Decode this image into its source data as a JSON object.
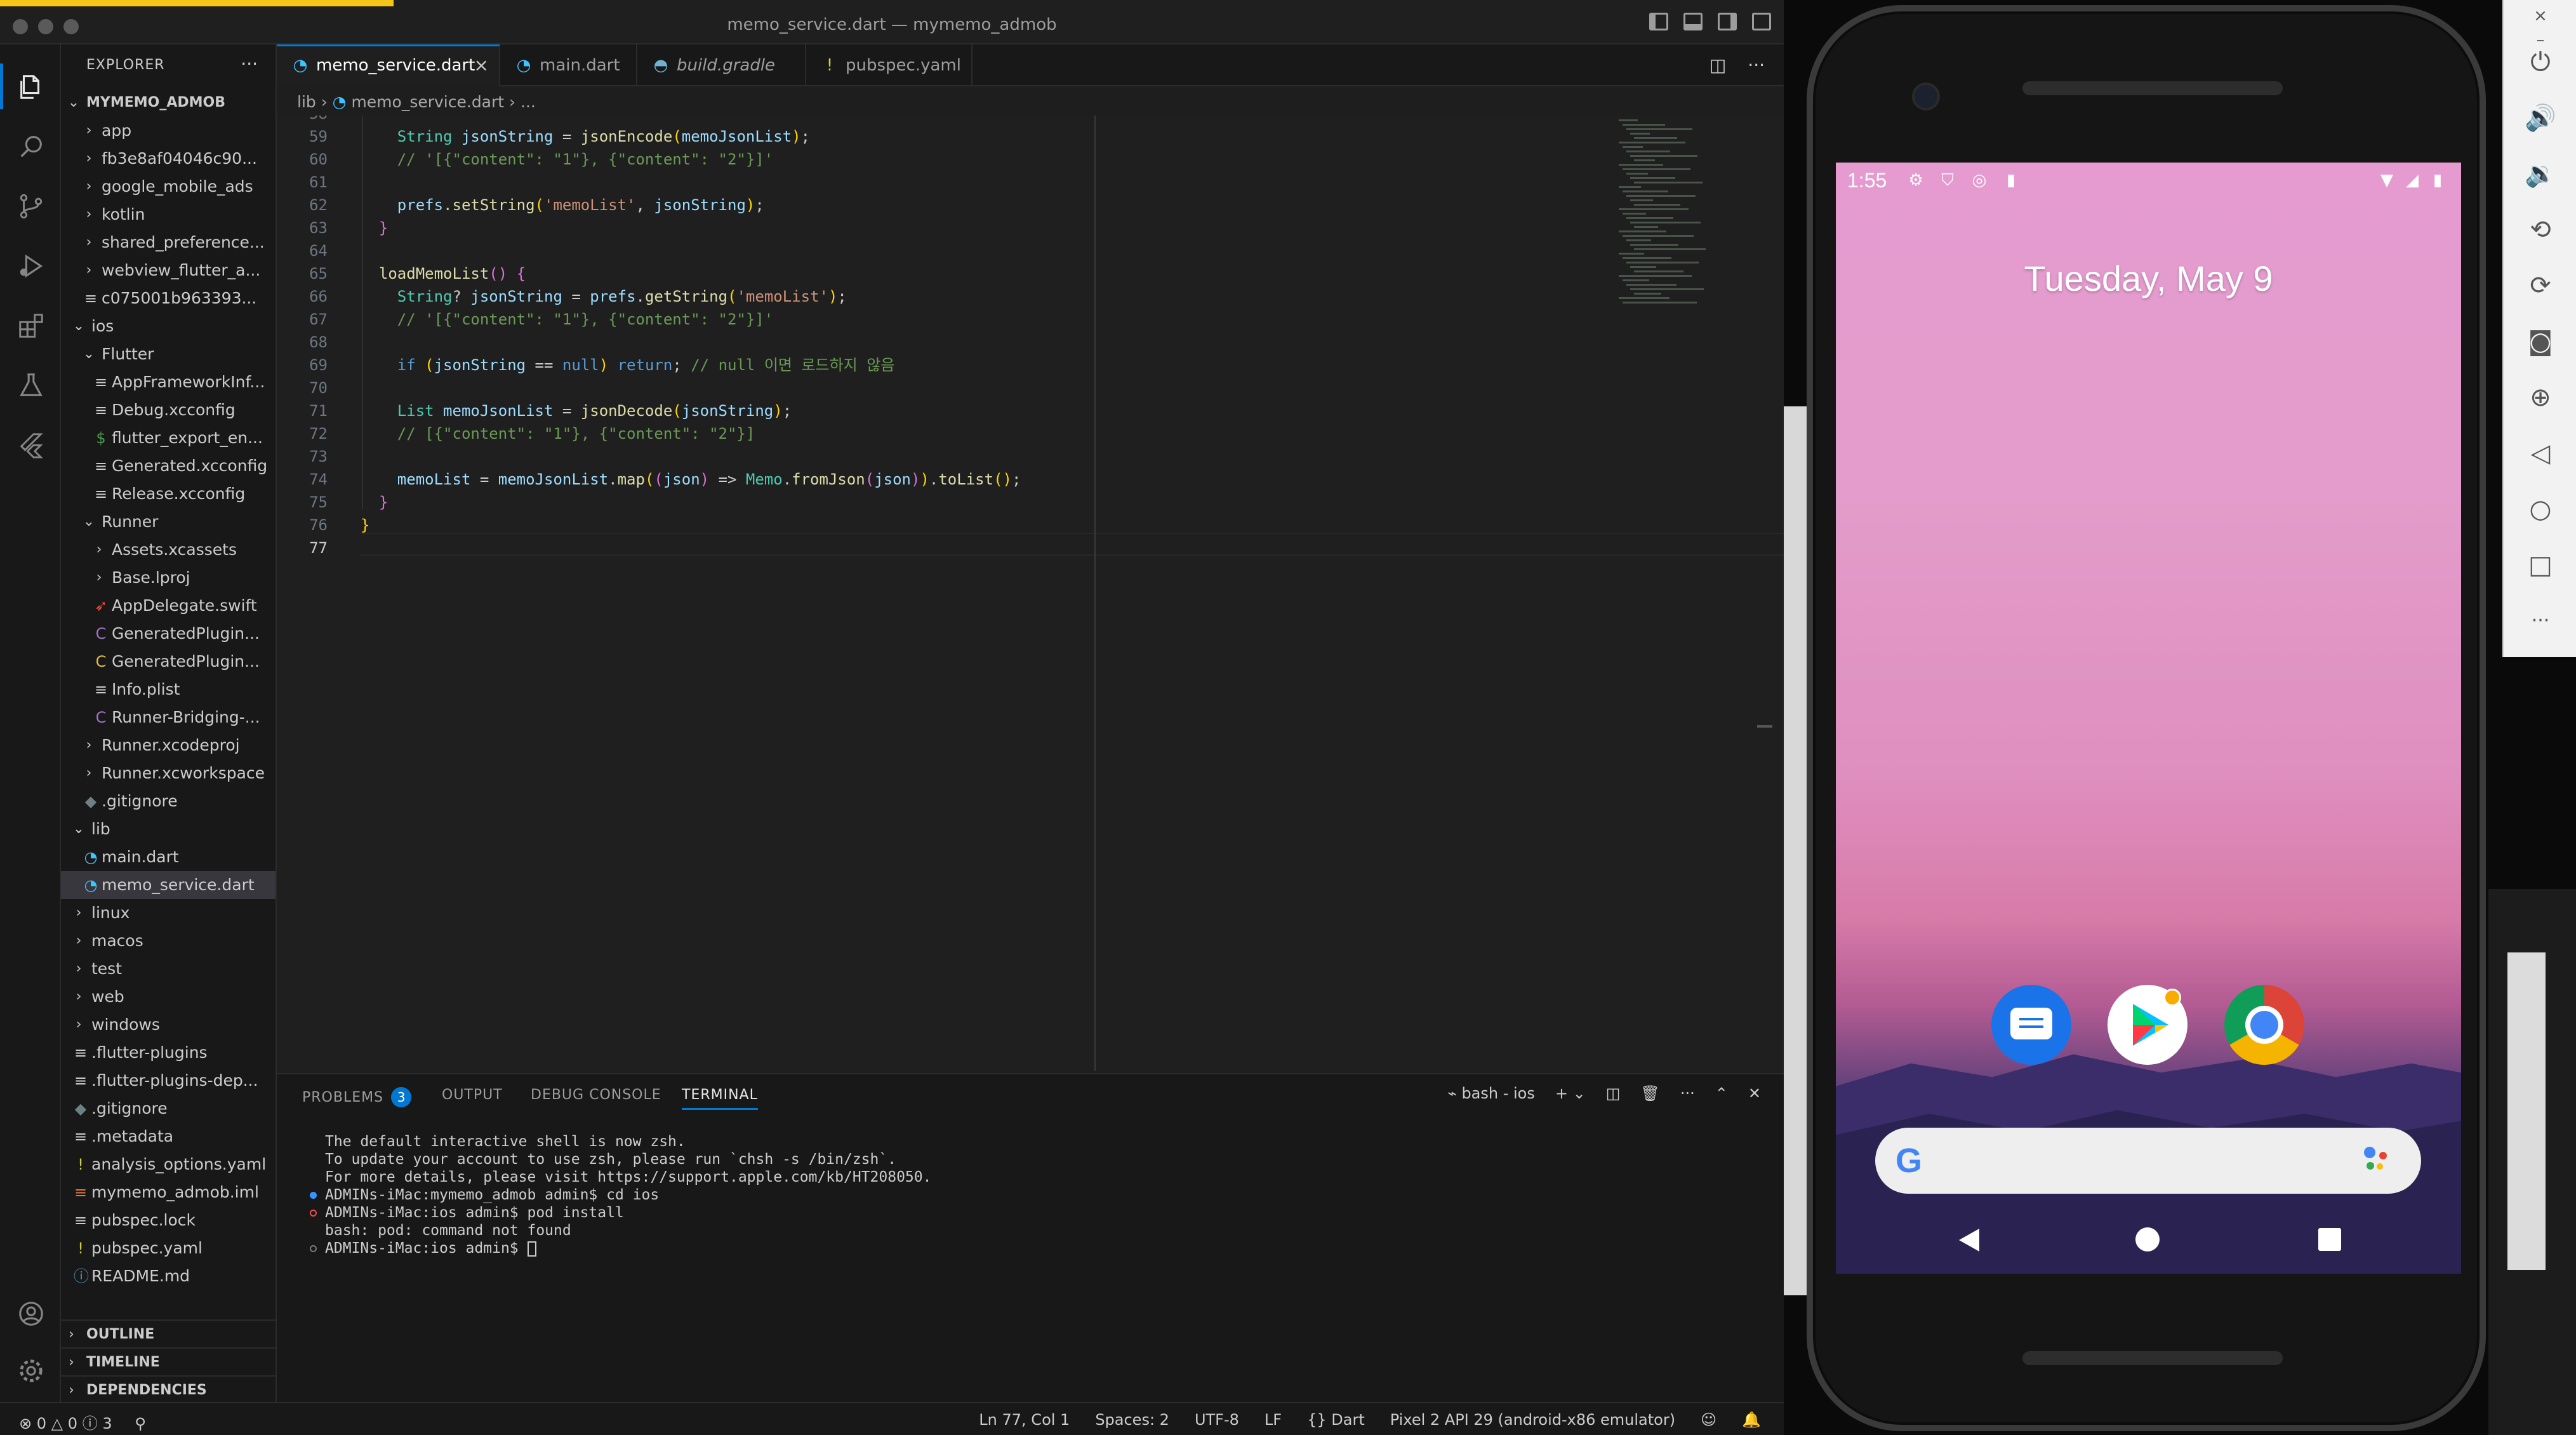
{
  "window": {
    "title": "memo_service.dart — mymemo_admob"
  },
  "explorer": {
    "title": "EXPLORER",
    "more": "···",
    "project": "MYMEMO_ADMOB",
    "items": [
      {
        "label": "app",
        "depth": 1,
        "type": "folder",
        "open": false
      },
      {
        "label": "fb3e8af04046c90...",
        "depth": 1,
        "type": "folder",
        "open": false
      },
      {
        "label": "google_mobile_ads",
        "depth": 1,
        "type": "folder",
        "open": false
      },
      {
        "label": "kotlin",
        "depth": 1,
        "type": "folder",
        "open": false
      },
      {
        "label": "shared_preference...",
        "depth": 1,
        "type": "folder",
        "open": false
      },
      {
        "label": "webview_flutter_a...",
        "depth": 1,
        "type": "folder",
        "open": false
      },
      {
        "label": "c075001b963393...",
        "depth": 1,
        "type": "file",
        "icon": "lines"
      },
      {
        "label": "ios",
        "depth": 0,
        "type": "folder",
        "open": true
      },
      {
        "label": "Flutter",
        "depth": 1,
        "type": "folder",
        "open": true
      },
      {
        "label": "AppFrameworkInf...",
        "depth": 2,
        "type": "file",
        "icon": "lines"
      },
      {
        "label": "Debug.xcconfig",
        "depth": 2,
        "type": "file",
        "icon": "lines"
      },
      {
        "label": "flutter_export_en...",
        "depth": 2,
        "type": "file",
        "icon": "dollar"
      },
      {
        "label": "Generated.xcconfig",
        "depth": 2,
        "type": "file",
        "icon": "lines"
      },
      {
        "label": "Release.xcconfig",
        "depth": 2,
        "type": "file",
        "icon": "lines"
      },
      {
        "label": "Runner",
        "depth": 1,
        "type": "folder",
        "open": true
      },
      {
        "label": "Assets.xcassets",
        "depth": 2,
        "type": "folder",
        "open": false
      },
      {
        "label": "Base.lproj",
        "depth": 2,
        "type": "folder",
        "open": false
      },
      {
        "label": "AppDelegate.swift",
        "depth": 2,
        "type": "file",
        "icon": "swift"
      },
      {
        "label": "GeneratedPlugin...",
        "depth": 2,
        "type": "file",
        "icon": "c-purple"
      },
      {
        "label": "GeneratedPlugin...",
        "depth": 2,
        "type": "file",
        "icon": "c-yellow"
      },
      {
        "label": "Info.plist",
        "depth": 2,
        "type": "file",
        "icon": "lines"
      },
      {
        "label": "Runner-Bridging-...",
        "depth": 2,
        "type": "file",
        "icon": "c-purple"
      },
      {
        "label": "Runner.xcodeproj",
        "depth": 1,
        "type": "folder",
        "open": false
      },
      {
        "label": "Runner.xcworkspace",
        "depth": 1,
        "type": "folder",
        "open": false
      },
      {
        "label": ".gitignore",
        "depth": 1,
        "type": "file",
        "icon": "git"
      },
      {
        "label": "lib",
        "depth": 0,
        "type": "folder",
        "open": true
      },
      {
        "label": "main.dart",
        "depth": 1,
        "type": "file",
        "icon": "dart"
      },
      {
        "label": "memo_service.dart",
        "depth": 1,
        "type": "file",
        "icon": "dart",
        "selected": true
      },
      {
        "label": "linux",
        "depth": 0,
        "type": "folder",
        "open": false
      },
      {
        "label": "macos",
        "depth": 0,
        "type": "folder",
        "open": false
      },
      {
        "label": "test",
        "depth": 0,
        "type": "folder",
        "open": false
      },
      {
        "label": "web",
        "depth": 0,
        "type": "folder",
        "open": false
      },
      {
        "label": "windows",
        "depth": 0,
        "type": "folder",
        "open": false
      },
      {
        "label": ".flutter-plugins",
        "depth": 0,
        "type": "file",
        "icon": "lines"
      },
      {
        "label": ".flutter-plugins-dep...",
        "depth": 0,
        "type": "file",
        "icon": "lines"
      },
      {
        "label": ".gitignore",
        "depth": 0,
        "type": "file",
        "icon": "git"
      },
      {
        "label": ".metadata",
        "depth": 0,
        "type": "file",
        "icon": "lines"
      },
      {
        "label": "analysis_options.yaml",
        "depth": 0,
        "type": "file",
        "icon": "excl"
      },
      {
        "label": "mymemo_admob.iml",
        "depth": 0,
        "type": "file",
        "icon": "iml"
      },
      {
        "label": "pubspec.lock",
        "depth": 0,
        "type": "file",
        "icon": "lines"
      },
      {
        "label": "pubspec.yaml",
        "depth": 0,
        "type": "file",
        "icon": "excl"
      },
      {
        "label": "README.md",
        "depth": 0,
        "type": "file",
        "icon": "info"
      }
    ],
    "sections": [
      "OUTLINE",
      "TIMELINE",
      "DEPENDENCIES"
    ]
  },
  "tabs": [
    {
      "label": "memo_service.dart",
      "icon": "dart",
      "active": true,
      "close": "×"
    },
    {
      "label": "main.dart",
      "icon": "dart"
    },
    {
      "label": "build.gradle",
      "icon": "gradle",
      "italic": true
    },
    {
      "label": "pubspec.yaml",
      "icon": "excl"
    }
  ],
  "breadcrumb": {
    "folder": "lib",
    "file": "memo_service.dart",
    "rest": "..."
  },
  "code": {
    "lines": [
      {
        "n": "58",
        "html": ""
      },
      {
        "n": "59",
        "html": "    <span class='ty'>String</span> <span class='vr'>jsonString</span> = <span class='fn'>jsonEncode</span><span class='br2'>(</span><span class='vr'>memoJsonList</span><span class='br2'>)</span>;"
      },
      {
        "n": "60",
        "html": "    <span class='cm'>// '[{\"content\": \"1\"}, {\"content\": \"2\"}]'</span>"
      },
      {
        "n": "61",
        "html": ""
      },
      {
        "n": "62",
        "html": "    <span class='vr'>prefs</span>.<span class='fn'>setString</span><span class='br2'>(</span><span class='str'>'memoList'</span>, <span class='vr'>jsonString</span><span class='br2'>)</span>;"
      },
      {
        "n": "63",
        "html": "  <span class='br'>}</span>"
      },
      {
        "n": "64",
        "html": ""
      },
      {
        "n": "65",
        "html": "  <span class='fn'>loadMemoList</span><span class='br'>()</span> <span class='br'>{</span>"
      },
      {
        "n": "66",
        "html": "    <span class='ty'>String</span>? <span class='vr'>jsonString</span> = <span class='vr'>prefs</span>.<span class='fn'>getString</span><span class='br2'>(</span><span class='str'>'memoList'</span><span class='br2'>)</span>;"
      },
      {
        "n": "67",
        "html": "    <span class='cm'>// '[{\"content\": \"1\"}, {\"content\": \"2\"}]'</span>"
      },
      {
        "n": "68",
        "html": ""
      },
      {
        "n": "69",
        "html": "    <span class='kw'>if</span> <span class='br2'>(</span><span class='vr'>jsonString</span> == <span class='kw'>null</span><span class='br2'>)</span> <span class='kw'>return</span>; <span class='cm'>// null 이면 로드하지 않음</span>"
      },
      {
        "n": "70",
        "html": ""
      },
      {
        "n": "71",
        "html": "    <span class='ty'>List</span> <span class='vr'>memoJsonList</span> = <span class='fn'>jsonDecode</span><span class='br2'>(</span><span class='vr'>jsonString</span><span class='br2'>)</span>;"
      },
      {
        "n": "72",
        "html": "    <span class='cm'>// [{\"content\": \"1\"}, {\"content\": \"2\"}]</span>"
      },
      {
        "n": "73",
        "html": ""
      },
      {
        "n": "74",
        "html": "    <span class='vr'>memoList</span> = <span class='vr'>memoJsonList</span>.<span class='fn'>map</span><span class='br2'>(</span><span class='br'>(</span><span class='vr'>json</span><span class='br'>)</span> => <span class='ty'>Memo</span>.<span class='fn'>fromJson</span><span class='br'>(</span><span class='vr'>json</span><span class='br'>)</span><span class='br2'>)</span>.<span class='fn'>toList</span><span class='br2'>()</span>;"
      },
      {
        "n": "75",
        "html": "  <span class='br'>}</span>"
      },
      {
        "n": "76",
        "html": "<span class='br2'>}</span>"
      },
      {
        "n": "77",
        "html": "",
        "current": true
      }
    ]
  },
  "panel": {
    "tabs": [
      "PROBLEMS",
      "OUTPUT",
      "DEBUG CONSOLE",
      "TERMINAL"
    ],
    "problems_count": "3",
    "active_tab": "TERMINAL",
    "terminal_name": "bash - ios",
    "terminal_lines": [
      {
        "text": "The default interactive shell is now zsh.",
        "dot": ""
      },
      {
        "text": "To update your account to use zsh, please run `chsh -s /bin/zsh`.",
        "dot": ""
      },
      {
        "text": "For more details, please visit https://support.apple.com/kb/HT208050.",
        "dot": ""
      },
      {
        "text": "ADMINs-iMac:mymemo_admob admin$ cd ios",
        "dot": "blue"
      },
      {
        "text": "ADMINs-iMac:ios admin$ pod install",
        "dot": "red"
      },
      {
        "text": "bash: pod: command not found",
        "dot": ""
      },
      {
        "text": "ADMINs-iMac:ios admin$ ",
        "dot": "hollow",
        "cursor": true
      }
    ]
  },
  "statusbar": {
    "errors": "0",
    "warnings": "0",
    "infos": "3",
    "position": "Ln 77, Col 1",
    "spaces": "Spaces: 2",
    "encoding": "UTF-8",
    "eol": "LF",
    "language": "Dart",
    "device": "Pixel 2 API 29 (android-x86 emulator)"
  },
  "android": {
    "time": "1:55",
    "date": "Tuesday, May 9",
    "apps": [
      "messages-icon",
      "play-store-icon",
      "chrome-icon"
    ],
    "colors": {
      "messages": "#1a73e8",
      "play_dot": "#f9ab00"
    }
  },
  "emulator_toolbar": {
    "close": "×",
    "minimize": "–",
    "more": "···"
  }
}
